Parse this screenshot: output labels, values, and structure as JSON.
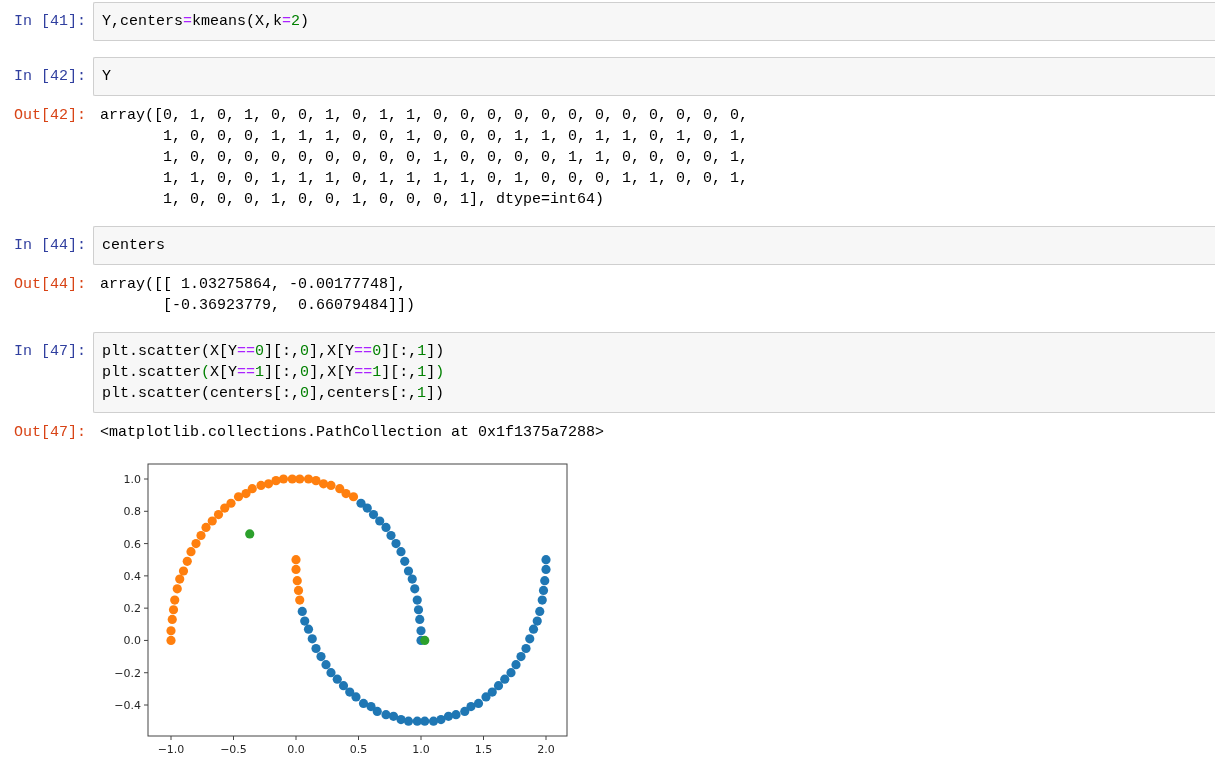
{
  "cells": [
    {
      "kind": "input",
      "prompt": "In [41]:",
      "lines": [
        [
          {
            "t": "Y,centers",
            "kind": "plain"
          },
          {
            "t": "=",
            "kind": "op"
          },
          {
            "t": "kmeans(X,k",
            "kind": "plain"
          },
          {
            "t": "=",
            "kind": "op"
          },
          {
            "t": "2",
            "kind": "num"
          },
          {
            "t": ")",
            "kind": "plain"
          }
        ]
      ]
    },
    {
      "kind": "input",
      "prompt": "In [42]:",
      "lines": [
        [
          {
            "t": "Y",
            "kind": "plain"
          }
        ]
      ]
    },
    {
      "kind": "output",
      "prompt": "Out[42]:",
      "lines": [
        "array([0, 1, 0, 1, 0, 0, 1, 0, 1, 1, 0, 0, 0, 0, 0, 0, 0, 0, 0, 0, 0, 0,",
        "       1, 0, 0, 0, 1, 1, 1, 0, 0, 1, 0, 0, 0, 1, 1, 0, 1, 1, 0, 1, 0, 1,",
        "       1, 0, 0, 0, 0, 0, 0, 0, 0, 0, 1, 0, 0, 0, 0, 1, 1, 0, 0, 0, 0, 1,",
        "       1, 1, 0, 0, 1, 1, 1, 0, 1, 1, 1, 1, 0, 1, 0, 0, 0, 1, 1, 0, 0, 1,",
        "       1, 0, 0, 0, 1, 0, 0, 1, 0, 0, 0, 1], dtype=int64)"
      ]
    },
    {
      "kind": "input",
      "prompt": "In [44]:",
      "lines": [
        [
          {
            "t": "centers",
            "kind": "plain"
          }
        ]
      ]
    },
    {
      "kind": "output",
      "prompt": "Out[44]:",
      "lines": [
        "array([[ 1.03275864, -0.00177748],",
        "       [-0.36923779,  0.66079484]])"
      ]
    },
    {
      "kind": "input",
      "prompt": "In [47]:",
      "lines": [
        [
          {
            "t": "plt.scatter(X[Y",
            "kind": "plain"
          },
          {
            "t": "==",
            "kind": "op"
          },
          {
            "t": "0",
            "kind": "num"
          },
          {
            "t": "][:,",
            "kind": "plain"
          },
          {
            "t": "0",
            "kind": "num"
          },
          {
            "t": "],X[Y",
            "kind": "plain"
          },
          {
            "t": "==",
            "kind": "op"
          },
          {
            "t": "0",
            "kind": "num"
          },
          {
            "t": "][:,",
            "kind": "plain"
          },
          {
            "t": "1",
            "kind": "num"
          },
          {
            "t": "])",
            "kind": "plain"
          }
        ],
        [
          {
            "t": "plt.scatter",
            "kind": "plain"
          },
          {
            "t": "(",
            "kind": "match"
          },
          {
            "t": "X[Y",
            "kind": "plain"
          },
          {
            "t": "==",
            "kind": "op"
          },
          {
            "t": "1",
            "kind": "num"
          },
          {
            "t": "][:,",
            "kind": "plain"
          },
          {
            "t": "0",
            "kind": "num"
          },
          {
            "t": "],X[Y",
            "kind": "plain"
          },
          {
            "t": "==",
            "kind": "op"
          },
          {
            "t": "1",
            "kind": "num"
          },
          {
            "t": "][:,",
            "kind": "plain"
          },
          {
            "t": "1",
            "kind": "num"
          },
          {
            "t": "]",
            "kind": "plain"
          },
          {
            "t": ")",
            "kind": "match"
          }
        ],
        [
          {
            "t": "plt.scatter(centers[:,",
            "kind": "plain"
          },
          {
            "t": "0",
            "kind": "num"
          },
          {
            "t": "],centers[:,",
            "kind": "plain"
          },
          {
            "t": "1",
            "kind": "num"
          },
          {
            "t": "])",
            "kind": "plain"
          }
        ]
      ]
    },
    {
      "kind": "output",
      "prompt": "Out[47]:",
      "lines": [
        "<matplotlib.collections.PathCollection at 0x1f1375a7288>"
      ]
    },
    {
      "kind": "plot",
      "chart_data": {
        "type": "scatter",
        "xlim": [
          -1.184,
          2.168
        ],
        "ylim": [
          -0.592,
          1.093
        ],
        "xticks": [
          {
            "value": -1,
            "label": "−1.0"
          },
          {
            "value": -0.5,
            "label": "−0.5"
          },
          {
            "value": 0,
            "label": "0.0"
          },
          {
            "value": 0.5,
            "label": "0.5"
          },
          {
            "value": 1,
            "label": "1.0"
          },
          {
            "value": 1.5,
            "label": "1.5"
          },
          {
            "value": 2,
            "label": "2.0"
          }
        ],
        "yticks": [
          {
            "value": -0.4,
            "label": "−0.4"
          },
          {
            "value": -0.2,
            "label": "−0.2"
          },
          {
            "value": 0,
            "label": "0.0"
          },
          {
            "value": 0.2,
            "label": "0.2"
          },
          {
            "value": 0.4,
            "label": "0.4"
          },
          {
            "value": 0.6,
            "label": "0.6"
          },
          {
            "value": 0.8,
            "label": "0.8"
          },
          {
            "value": 1,
            "label": "1.0"
          }
        ],
        "series": [
          {
            "color": "#1f77b4",
            "x": [
              1.0,
              1.0,
              0.99,
              0.98,
              0.97,
              0.95,
              0.93,
              0.9,
              0.87,
              0.84,
              0.8,
              0.76,
              0.72,
              0.67,
              0.62,
              0.57,
              0.52,
              0.05,
              0.07,
              0.1,
              0.13,
              0.16,
              0.2,
              0.24,
              0.28,
              0.33,
              0.38,
              0.43,
              0.48,
              0.54,
              0.6,
              0.65,
              0.72,
              0.78,
              0.84,
              0.9,
              0.97,
              1.03,
              1.1,
              1.16,
              1.22,
              1.28,
              1.35,
              1.4,
              1.46,
              1.52,
              1.57,
              1.62,
              1.67,
              1.72,
              1.76,
              1.8,
              1.84,
              1.87,
              1.9,
              1.93,
              1.95,
              1.97,
              1.98,
              1.99,
              2.0,
              2.0
            ],
            "values": [
              0.0,
              0.06,
              0.13,
              0.19,
              0.25,
              0.32,
              0.38,
              0.43,
              0.49,
              0.55,
              0.6,
              0.65,
              0.7,
              0.74,
              0.78,
              0.82,
              0.85,
              0.18,
              0.12,
              0.07,
              0.01,
              -0.05,
              -0.1,
              -0.15,
              -0.2,
              -0.24,
              -0.28,
              -0.32,
              -0.35,
              -0.39,
              -0.41,
              -0.44,
              -0.46,
              -0.47,
              -0.49,
              -0.5,
              -0.5,
              -0.5,
              -0.5,
              -0.49,
              -0.47,
              -0.46,
              -0.44,
              -0.41,
              -0.39,
              -0.35,
              -0.32,
              -0.28,
              -0.24,
              -0.2,
              -0.15,
              -0.1,
              -0.05,
              0.01,
              0.07,
              0.12,
              0.18,
              0.25,
              0.31,
              0.37,
              0.44,
              0.5
            ]
          },
          {
            "color": "#ff7f0e",
            "x": [
              0.46,
              0.4,
              0.35,
              0.28,
              0.22,
              0.16,
              0.1,
              0.03,
              -0.03,
              -0.1,
              -0.16,
              -0.22,
              -0.28,
              -0.35,
              -0.4,
              -0.46,
              -0.52,
              -0.57,
              -0.62,
              -0.67,
              -0.72,
              -0.76,
              -0.8,
              -0.84,
              -0.87,
              -0.9,
              -0.93,
              -0.95,
              -0.97,
              -0.98,
              -0.99,
              -1.0,
              -1.0,
              0.0,
              0.0,
              0.01,
              0.02,
              0.03
            ],
            "values": [
              0.89,
              0.91,
              0.94,
              0.96,
              0.97,
              0.99,
              1.0,
              1.0,
              1.0,
              1.0,
              0.99,
              0.97,
              0.96,
              0.94,
              0.91,
              0.89,
              0.85,
              0.82,
              0.78,
              0.74,
              0.7,
              0.65,
              0.6,
              0.55,
              0.49,
              0.43,
              0.38,
              0.32,
              0.25,
              0.19,
              0.13,
              0.06,
              0.0,
              0.5,
              0.44,
              0.37,
              0.31,
              0.25
            ]
          },
          {
            "color": "#2ca02c",
            "x": [
              1.03,
              -0.37
            ],
            "values": [
              0.0,
              0.66
            ]
          }
        ]
      }
    }
  ]
}
